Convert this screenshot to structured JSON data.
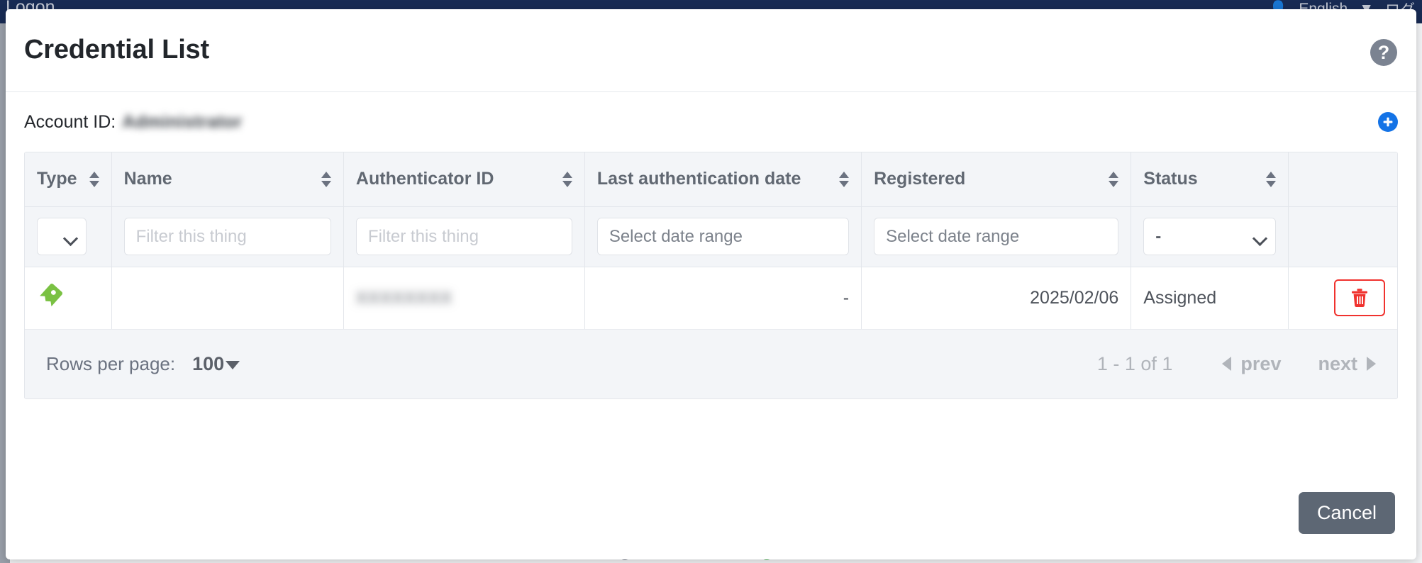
{
  "background": {
    "topbar": {
      "app_label": "Logon",
      "language": "English",
      "language_caret": "▼",
      "right_truncated": "ログ"
    }
  },
  "modal": {
    "title": "Credential List",
    "help_icon_glyph": "?",
    "help_icon_name": "question-mark-circle-icon",
    "account": {
      "label": "Account ID:",
      "value": "Administrator"
    },
    "add_button_label": "+",
    "table": {
      "columns": [
        {
          "key": "type",
          "label": "Type",
          "sortable": true
        },
        {
          "key": "name",
          "label": "Name",
          "sortable": true
        },
        {
          "key": "authenticator_id",
          "label": "Authenticator ID",
          "sortable": true
        },
        {
          "key": "last_auth_date",
          "label": "Last authentication date",
          "sortable": true
        },
        {
          "key": "registered",
          "label": "Registered",
          "sortable": true
        },
        {
          "key": "status",
          "label": "Status",
          "sortable": true
        },
        {
          "key": "actions",
          "label": "",
          "sortable": false
        }
      ],
      "filters": {
        "type_selected": "",
        "name_placeholder": "Filter this thing",
        "authenticator_id_placeholder": "Filter this thing",
        "last_auth_date_placeholder": "Select date range",
        "registered_placeholder": "Select date range",
        "status_selected": "-"
      },
      "rows": [
        {
          "type_icon": "tag-icon",
          "name": "",
          "authenticator_id": "XXXXXXXX",
          "last_auth_date": "-",
          "registered": "2025/02/06",
          "status": "Assigned",
          "delete_icon": "trash-icon"
        }
      ]
    },
    "footer": {
      "rows_per_page_label": "Rows per page:",
      "rows_per_page_value": "100",
      "range_text": "1 - 1 of 1",
      "prev_label": "prev",
      "next_label": "next"
    },
    "cancel_label": "Cancel"
  },
  "colors": {
    "accent_blue": "#1473e6",
    "danger_red": "#f0322e",
    "tag_green": "#7ac143",
    "header_navy": "#182b54",
    "cancel_gray": "#5d6774"
  }
}
